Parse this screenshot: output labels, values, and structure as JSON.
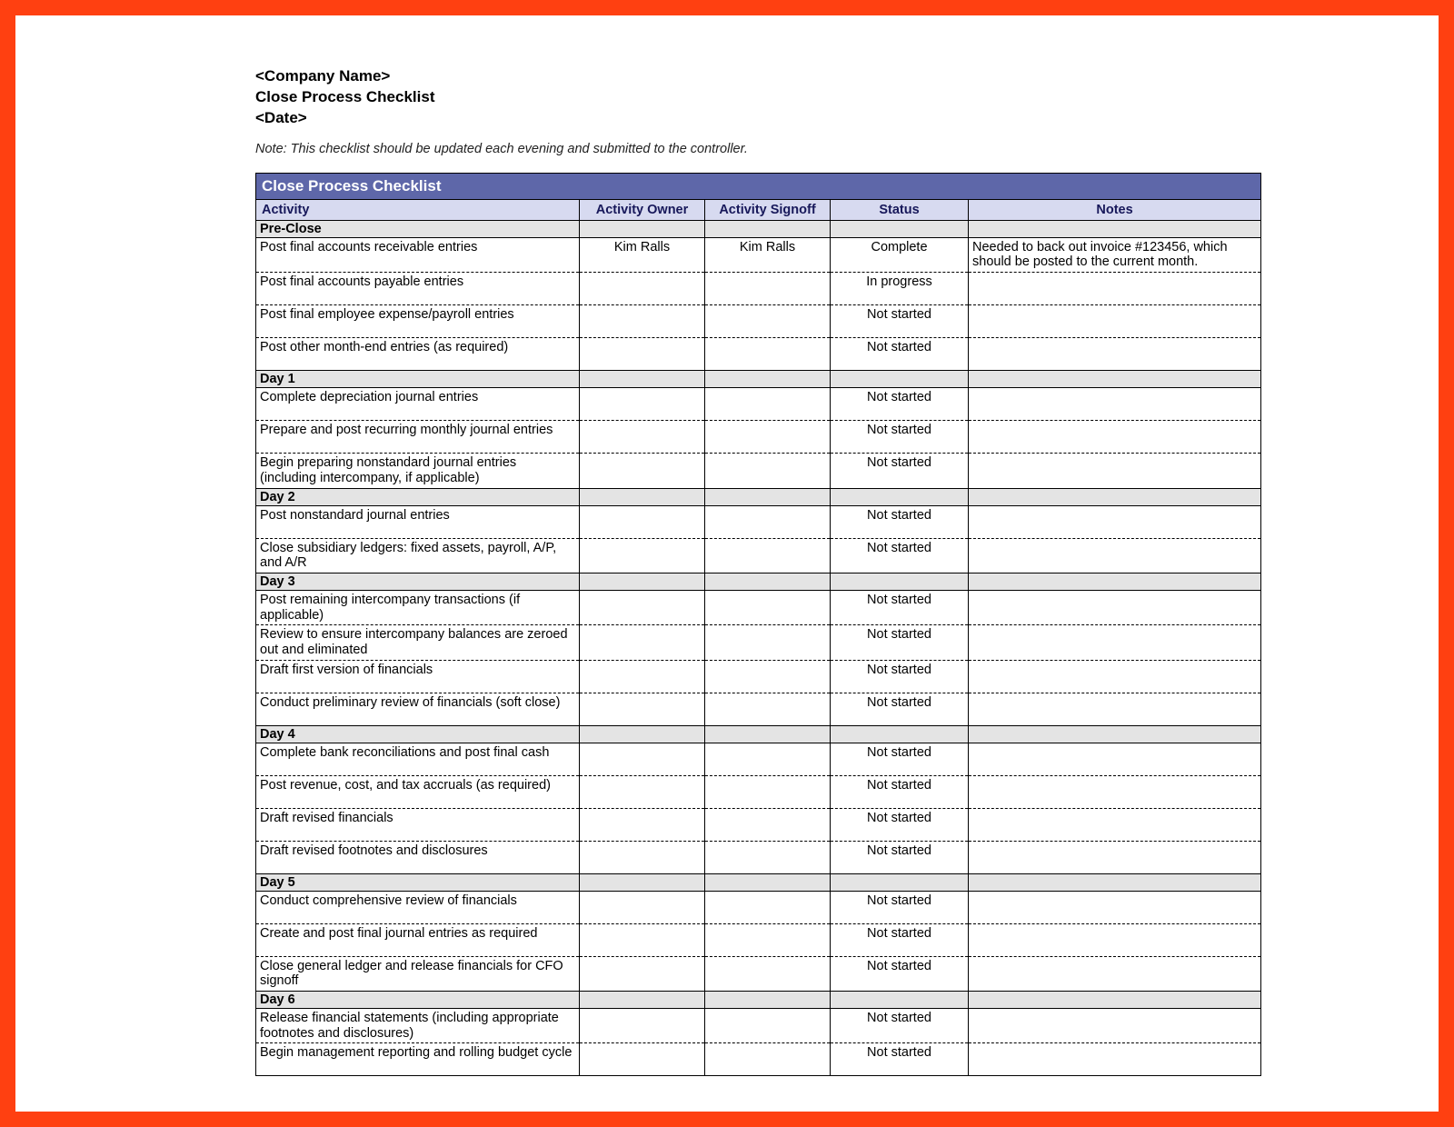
{
  "heading": {
    "company": "<Company Name>",
    "title": "Close Process Checklist",
    "date": "<Date>"
  },
  "note": "Note: This checklist should be updated each evening and submitted to the controller.",
  "table": {
    "title": "Close Process Checklist",
    "columns": {
      "activity": "Activity",
      "owner": "Activity Owner",
      "signoff": "Activity Signoff",
      "status": "Status",
      "notes": "Notes"
    },
    "sections": [
      {
        "label": "Pre-Close",
        "rows": [
          {
            "activity": "Post final accounts receivable entries",
            "owner": "Kim Ralls",
            "signoff": "Kim Ralls",
            "status": "Complete",
            "notes": "Needed to back out invoice #123456, which should be posted to the current month."
          },
          {
            "activity": "Post final accounts payable entries",
            "owner": "",
            "signoff": "",
            "status": "In progress",
            "notes": ""
          },
          {
            "activity": "Post final employee expense/payroll entries",
            "owner": "",
            "signoff": "",
            "status": "Not started",
            "notes": ""
          },
          {
            "activity": "Post other month-end entries (as required)",
            "owner": "",
            "signoff": "",
            "status": "Not started",
            "notes": ""
          }
        ]
      },
      {
        "label": "Day 1",
        "rows": [
          {
            "activity": "Complete depreciation journal entries",
            "owner": "",
            "signoff": "",
            "status": "Not started",
            "notes": ""
          },
          {
            "activity": "Prepare and post recurring monthly journal entries",
            "owner": "",
            "signoff": "",
            "status": "Not started",
            "notes": ""
          },
          {
            "activity": "Begin preparing nonstandard journal entries (including intercompany, if applicable)",
            "owner": "",
            "signoff": "",
            "status": "Not started",
            "notes": ""
          }
        ]
      },
      {
        "label": "Day 2",
        "rows": [
          {
            "activity": "Post nonstandard journal entries",
            "owner": "",
            "signoff": "",
            "status": "Not started",
            "notes": ""
          },
          {
            "activity": "Close subsidiary ledgers: fixed assets, payroll, A/P, and A/R",
            "owner": "",
            "signoff": "",
            "status": "Not started",
            "notes": ""
          }
        ]
      },
      {
        "label": "Day 3",
        "rows": [
          {
            "activity": "Post remaining intercompany transactions (if applicable)",
            "owner": "",
            "signoff": "",
            "status": "Not started",
            "notes": ""
          },
          {
            "activity": "Review to ensure intercompany balances are zeroed out and eliminated",
            "owner": "",
            "signoff": "",
            "status": "Not started",
            "notes": ""
          },
          {
            "activity": "Draft first version of financials",
            "owner": "",
            "signoff": "",
            "status": "Not started",
            "notes": ""
          },
          {
            "activity": "Conduct preliminary review of financials (soft close)",
            "owner": "",
            "signoff": "",
            "status": "Not started",
            "notes": ""
          }
        ]
      },
      {
        "label": "Day 4",
        "rows": [
          {
            "activity": "Complete bank reconciliations and post final cash",
            "owner": "",
            "signoff": "",
            "status": "Not started",
            "notes": ""
          },
          {
            "activity": "Post revenue, cost, and tax accruals (as required)",
            "owner": "",
            "signoff": "",
            "status": "Not started",
            "notes": ""
          },
          {
            "activity": "Draft revised financials",
            "owner": "",
            "signoff": "",
            "status": "Not started",
            "notes": ""
          },
          {
            "activity": "Draft revised footnotes and disclosures",
            "owner": "",
            "signoff": "",
            "status": "Not started",
            "notes": ""
          }
        ]
      },
      {
        "label": "Day 5",
        "rows": [
          {
            "activity": "Conduct comprehensive review of financials",
            "owner": "",
            "signoff": "",
            "status": "Not started",
            "notes": ""
          },
          {
            "activity": "Create and post final journal entries as required",
            "owner": "",
            "signoff": "",
            "status": "Not started",
            "notes": ""
          },
          {
            "activity": "Close general ledger and release financials for CFO signoff",
            "owner": "",
            "signoff": "",
            "status": "Not started",
            "notes": ""
          }
        ]
      },
      {
        "label": "Day 6",
        "rows": [
          {
            "activity": "Release financial statements (including appropriate footnotes and disclosures)",
            "owner": "",
            "signoff": "",
            "status": "Not started",
            "notes": ""
          },
          {
            "activity": "Begin management reporting and rolling budget cycle",
            "owner": "",
            "signoff": "",
            "status": "Not started",
            "notes": ""
          }
        ]
      }
    ]
  }
}
